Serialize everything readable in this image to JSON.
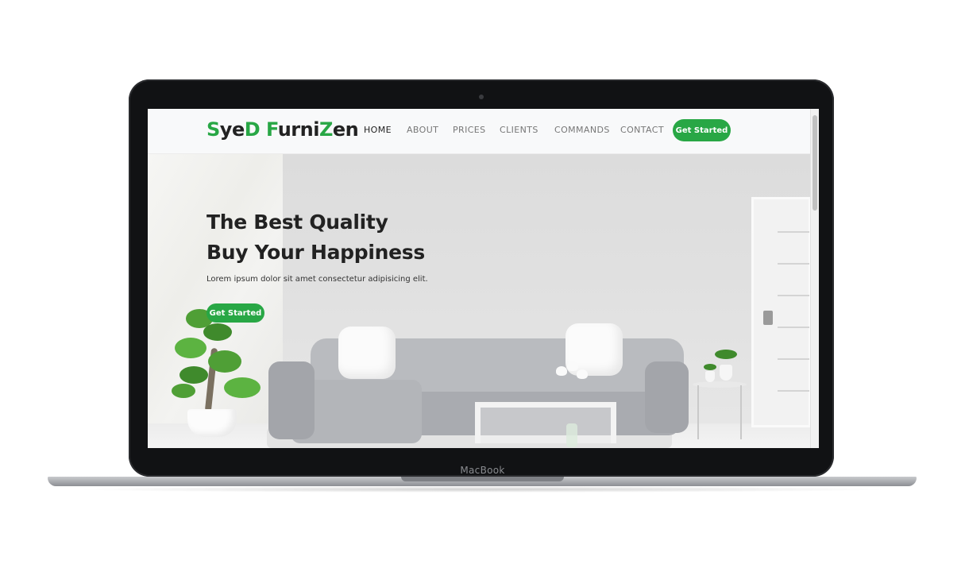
{
  "device": {
    "label": "MacBook"
  },
  "header": {
    "logo": {
      "letters": [
        "S",
        "ye",
        "D",
        " ",
        "F",
        "urni",
        "Z",
        "en"
      ]
    },
    "nav": [
      {
        "label": "HOME",
        "active": true
      },
      {
        "label": "ABOUT",
        "active": false
      },
      {
        "label": "PRICES",
        "active": false
      },
      {
        "label": "CLIENTS",
        "active": false
      },
      {
        "label": "COMMANDS",
        "active": false
      },
      {
        "label": "CONTACT",
        "active": false
      }
    ],
    "cta_label": "Get Started"
  },
  "hero": {
    "title_line1": "The Best Quality",
    "title_line2": "Buy Your Happiness",
    "subtitle": "Lorem ipsum dolor sit amet consectetur adipisicing elit.",
    "cta_label": "Get Started"
  },
  "colors": {
    "accent": "#28a745",
    "text": "#222222"
  }
}
